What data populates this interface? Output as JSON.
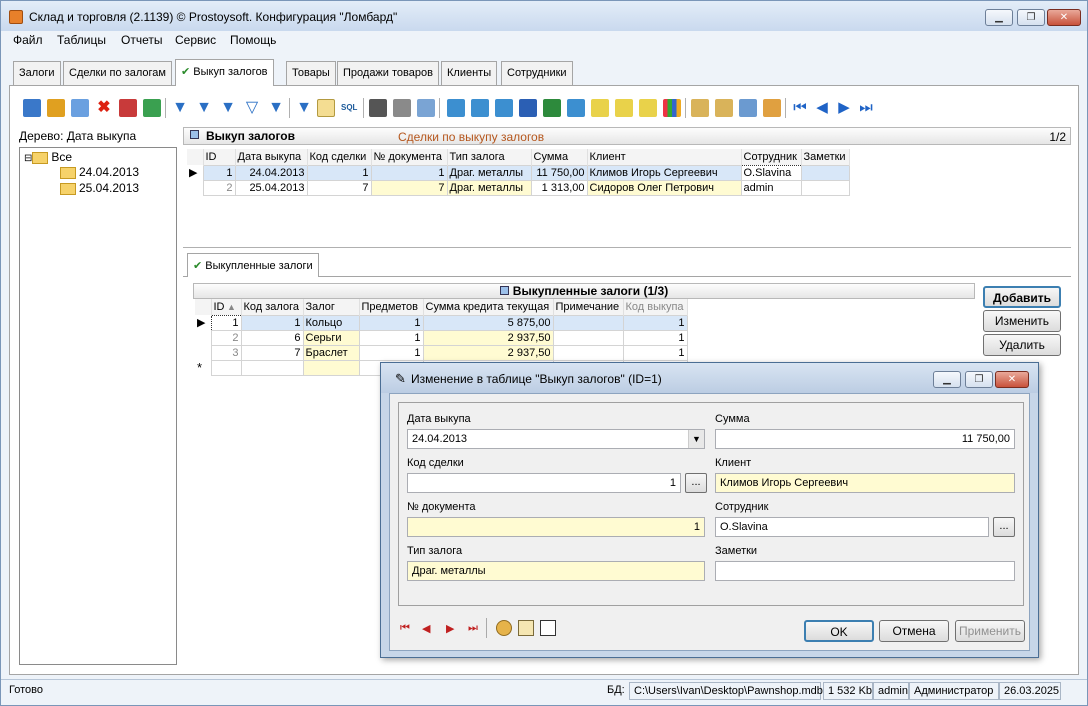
{
  "window": {
    "title": "Склад и торговля (2.1139) © Prostoysoft. Конфигурация \"Ломбард\""
  },
  "menu": [
    "Файл",
    "Таблицы",
    "Отчеты",
    "Сервис",
    "Помощь"
  ],
  "tabs": [
    "Залоги",
    "Сделки по залогам",
    "Выкуп залогов",
    "Товары",
    "Продажи товаров",
    "Клиенты",
    "Сотрудники"
  ],
  "tree": {
    "label": "Дерево: Дата выкупа",
    "root": "Все",
    "children": [
      "24.04.2013",
      "25.04.2013"
    ]
  },
  "top_grid": {
    "title": "Выкуп залогов",
    "link": "Сделки по выкупу залогов",
    "pager": "1/2",
    "columns": [
      "ID",
      "Дата выкупа",
      "Код сделки",
      "№ документа",
      "Тип залога",
      "Сумма",
      "Клиент",
      "Сотрудник",
      "Заметки"
    ],
    "rows": [
      [
        "1",
        "24.04.2013",
        "1",
        "1",
        "Драг. металлы",
        "11 750,00",
        "Климов Игорь Сергеевич",
        "O.Slavina",
        ""
      ],
      [
        "2",
        "25.04.2013",
        "7",
        "7",
        "Драг. металлы",
        "1 313,00",
        "Сидоров Олег Петрович",
        "admin",
        ""
      ]
    ]
  },
  "detail_tab": "Выкупленные залоги",
  "bottom_grid": {
    "title": "Выкупленные залоги (1/3)",
    "columns": [
      "ID",
      "Код залога",
      "Залог",
      "Предметов",
      "Сумма кредита текущая",
      "Примечание",
      "Код выкупа"
    ],
    "rows": [
      [
        "1",
        "1",
        "Кольцо",
        "1",
        "5 875,00",
        "",
        "1"
      ],
      [
        "2",
        "6",
        "Серьги",
        "1",
        "2 937,50",
        "",
        "1"
      ],
      [
        "3",
        "7",
        "Браслет",
        "1",
        "2 937,50",
        "",
        "1"
      ]
    ],
    "new_row_marker": "*"
  },
  "side_buttons": [
    "Добавить",
    "Изменить",
    "Удалить"
  ],
  "dialog": {
    "title": "Изменение в таблице \"Выкуп залогов\" (ID=1)",
    "date_label": "Дата выкупа",
    "date_value": "24.04.2013",
    "sum_label": "Сумма",
    "sum_value": "11 750,00",
    "deal_label": "Код сделки",
    "deal_value": "1",
    "client_label": "Клиент",
    "client_value": "Климов Игорь Сергеевич",
    "doc_label": "№ документа",
    "doc_value": "1",
    "emp_label": "Сотрудник",
    "emp_value": "O.Slavina",
    "type_label": "Тип залога",
    "type_value": "Драг. металлы",
    "notes_label": "Заметки",
    "notes_value": "",
    "ok": "OK",
    "cancel": "Отмена",
    "apply": "Применить",
    "dots": "..."
  },
  "status": {
    "ready": "Готово",
    "db_label": "БД:",
    "db_path": "C:\\Users\\Ivan\\Desktop\\Pawnshop.mdb",
    "size": "1 532 Kb",
    "user": "admin",
    "role": "Администратор",
    "date": "26.03.2025"
  }
}
